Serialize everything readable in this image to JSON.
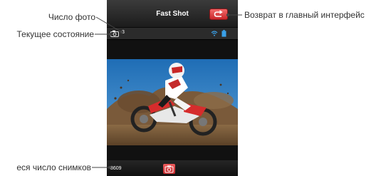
{
  "app": {
    "title": "Fast Shot"
  },
  "status_bar": {
    "photo_count": "3",
    "camera_status_icon": "camera-status-icon",
    "wifi_icon": "wifi-icon",
    "battery_icon": "battery-icon"
  },
  "toolbar": {
    "back_icon": "back-arrow-icon",
    "shutter_icon": "camera-icon",
    "remaining_shots": "8609"
  },
  "annotations": {
    "photo_count": "Число фото",
    "current_state": "Текущее состояние",
    "back_to_main": "Возврат в главный интерфейс",
    "remaining_shots": "еся число снимков"
  },
  "colors": {
    "accent_red": "#d8383b",
    "wifi_blue": "#3aa0e8",
    "screen_bg": "#000000"
  }
}
